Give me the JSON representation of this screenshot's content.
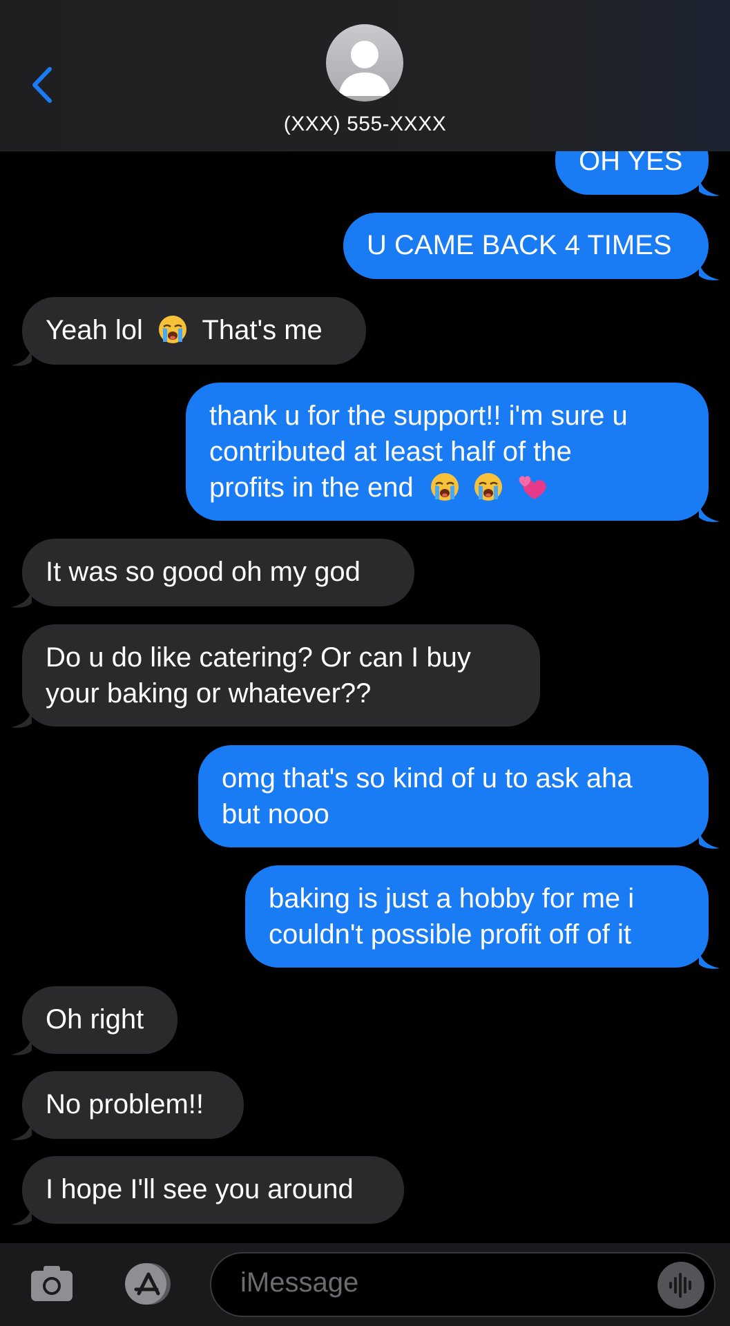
{
  "header": {
    "contact_name": "(XXX) 555-XXXX",
    "back_icon": "chevron-left-icon",
    "avatar_icon": "person-icon"
  },
  "messages": [
    {
      "from": "me",
      "text": "OH YES"
    },
    {
      "from": "me",
      "text": "U CAME BACK 4 TIMES"
    },
    {
      "from": "them",
      "text_a": "Yeah lol",
      "emoji": "loudly-crying-face",
      "text_b": "That's me"
    },
    {
      "from": "me",
      "line1": "thank u for the support!! i'm sure u",
      "line2": "contributed at least half of the",
      "line3": "profits in the end",
      "emojis": [
        "loudly-crying-face",
        "loudly-crying-face",
        "two-hearts"
      ]
    },
    {
      "from": "them",
      "text": "It was so good oh my god"
    },
    {
      "from": "them",
      "line1": "Do u do like catering? Or can I buy",
      "line2": "your baking or whatever??"
    },
    {
      "from": "me",
      "line1": "omg that's so kind of u to ask aha",
      "line2": "but nooo"
    },
    {
      "from": "me",
      "line1": "baking is just a hobby for me i",
      "line2": "couldn't possible profit off of it"
    },
    {
      "from": "them",
      "text": "Oh right"
    },
    {
      "from": "them",
      "text": "No problem!!"
    },
    {
      "from": "them",
      "text": "I hope I'll see you around"
    }
  ],
  "input": {
    "placeholder": "iMessage",
    "camera_icon": "camera-icon",
    "apps_icon": "app-store-icon",
    "audio_icon": "audio-waveform-icon"
  },
  "colors": {
    "sent_bubble": "#1a7cf5",
    "received_bubble": "#2a2a2c",
    "accent": "#1a7cf5"
  }
}
